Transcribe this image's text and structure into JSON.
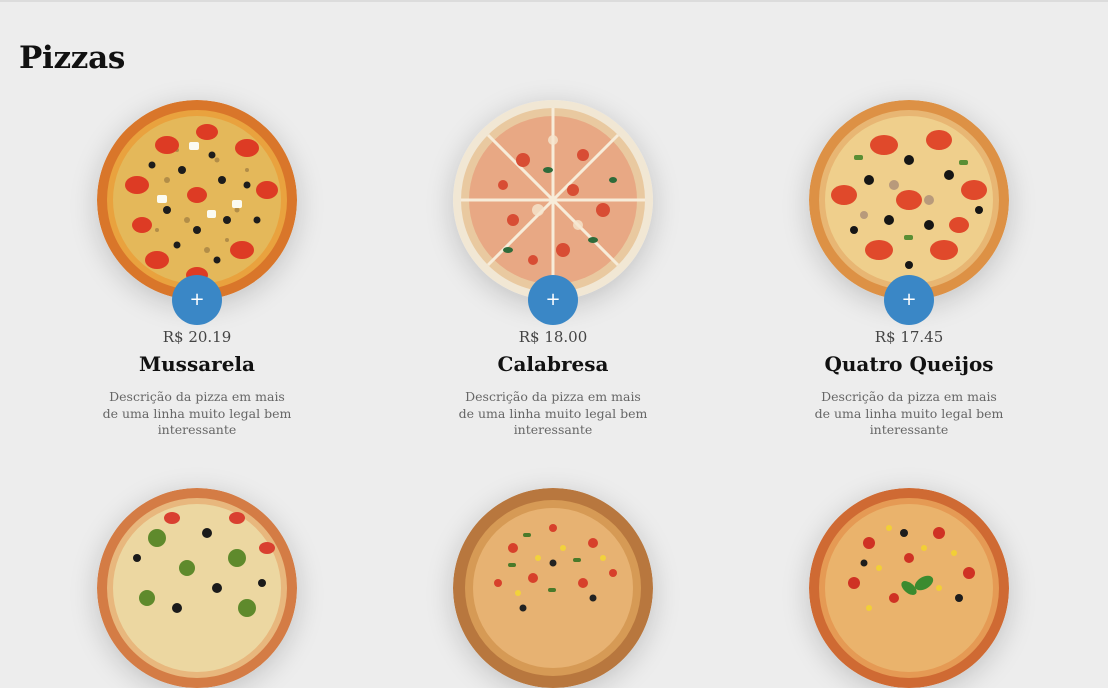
{
  "page": {
    "title": "Pizzas"
  },
  "pizzas": [
    {
      "name": "Mussarela",
      "price": "R$ 20.19",
      "description": "Descrição da pizza em mais de uma linha muito legal bem interessante",
      "add_label": "+",
      "image": "pizza-pepperoni-tomato"
    },
    {
      "name": "Calabresa",
      "price": "R$ 18.00",
      "description": "Descrição da pizza em mais de uma linha muito legal bem interessante",
      "add_label": "+",
      "image": "pizza-calabresa-sliced"
    },
    {
      "name": "Quatro Queijos",
      "price": "R$ 17.45",
      "description": "Descrição da pizza em mais de uma linha muito legal bem interessante",
      "add_label": "+",
      "image": "pizza-tomato-olive"
    },
    {
      "image": "pizza-broccoli-olive"
    },
    {
      "image": "pizza-on-wooden-board"
    },
    {
      "image": "pizza-basil-olive"
    }
  ],
  "colors": {
    "background": "#ededed",
    "accent": "#3a87c6"
  }
}
